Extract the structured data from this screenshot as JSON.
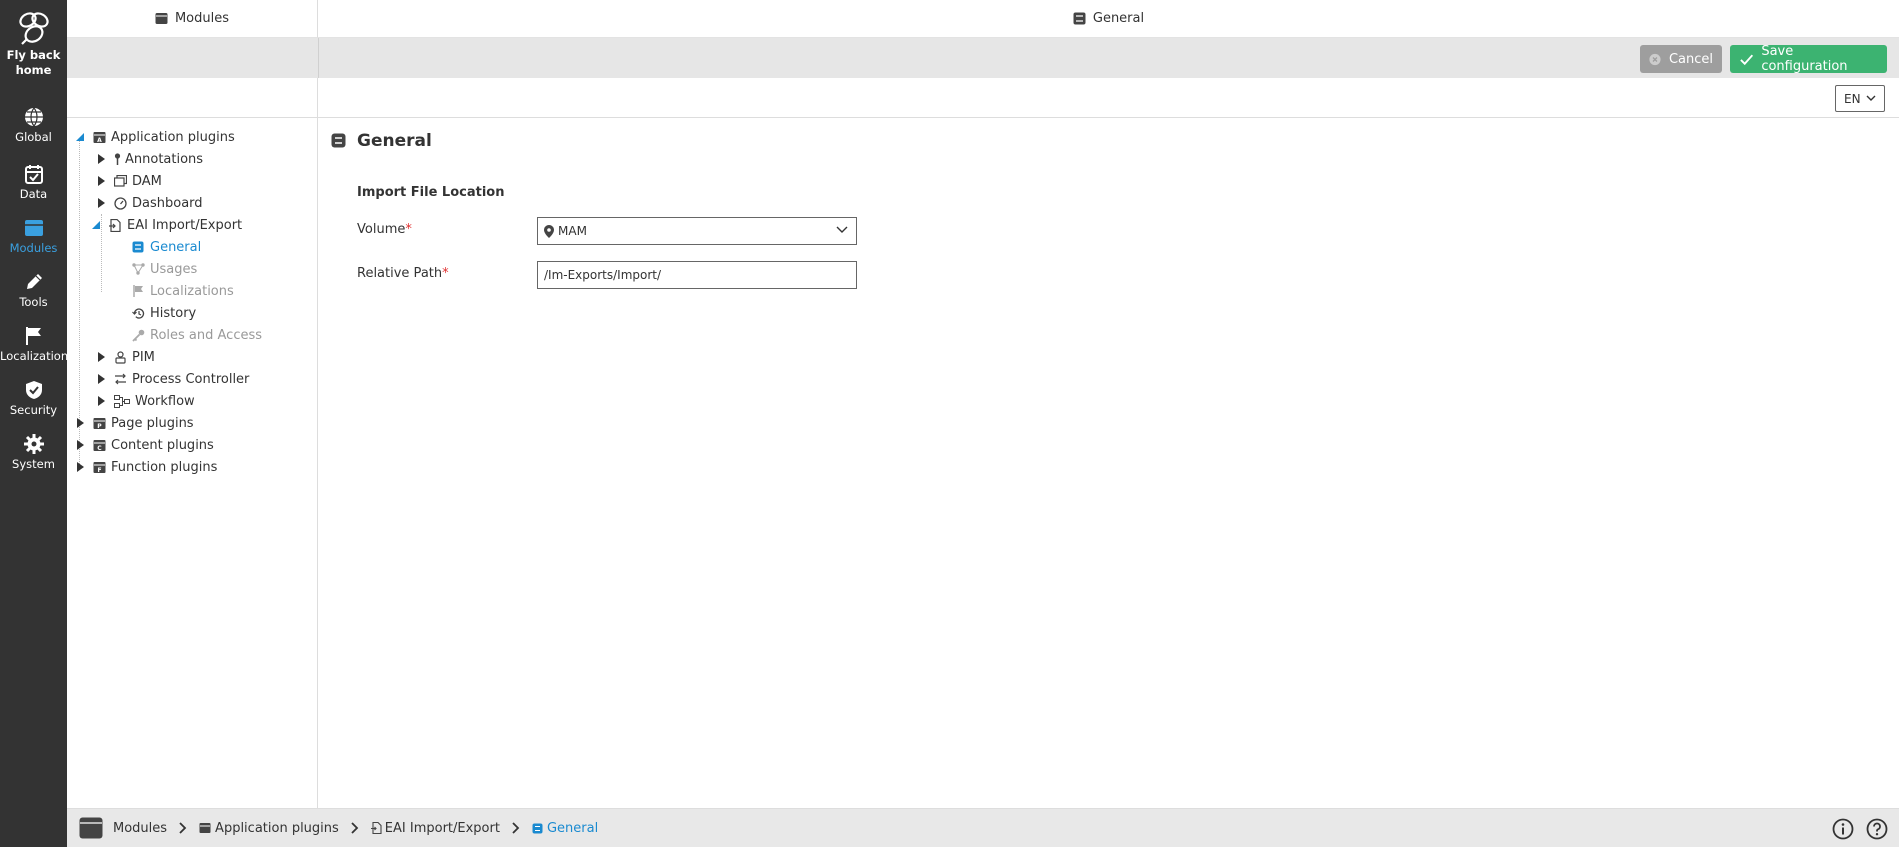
{
  "rail": {
    "home_label": "Fly back home",
    "items": [
      {
        "label": "Global",
        "icon": "globe-icon"
      },
      {
        "label": "Data",
        "icon": "calendar-icon"
      },
      {
        "label": "Modules",
        "icon": "modules-icon"
      },
      {
        "label": "Tools",
        "icon": "pencil-icon"
      },
      {
        "label": "Localization",
        "icon": "flag-icon"
      },
      {
        "label": "Security",
        "icon": "shield-icon"
      },
      {
        "label": "System",
        "icon": "gear-icon"
      }
    ],
    "active": "Modules",
    "accent": "#3aa0e0"
  },
  "headers": {
    "tree": "Modules",
    "main": "General"
  },
  "toolbar": {
    "cancel": "Cancel",
    "save": "Save configuration",
    "save_color": "#3cb371",
    "cancel_color": "#9e9e9e"
  },
  "language": "EN",
  "tree": {
    "app_plugins": "Application plugins",
    "annotations": "Annotations",
    "dam": "DAM",
    "dashboard": "Dashboard",
    "eai": "EAI Import/Export",
    "general": "General",
    "usages": "Usages",
    "localizations": "Localizations",
    "history": "History",
    "roles": "Roles and Access",
    "pim": "PIM",
    "process": "Process Controller",
    "workflow": "Workflow",
    "page_plugins": "Page plugins",
    "content_plugins": "Content plugins",
    "function_plugins": "Function plugins"
  },
  "form": {
    "title": "General",
    "section": "Import File Location",
    "volume_label": "Volume",
    "volume_value": "MAM",
    "path_label": "Relative Path",
    "path_value": "/Im-Exports/Import/",
    "required_mark": "*"
  },
  "breadcrumb": [
    "Modules",
    "Application plugins",
    "EAI Import/Export",
    "General"
  ]
}
